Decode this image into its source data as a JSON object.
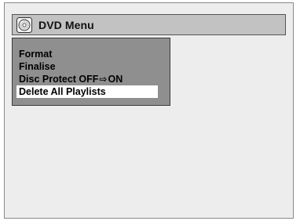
{
  "window": {
    "title": "DVD Menu",
    "icon": "disc-icon"
  },
  "menu": {
    "items": [
      {
        "label": "Format",
        "selected": false
      },
      {
        "label": "Finalise",
        "selected": false
      },
      {
        "label_before": "Disc Protect OFF",
        "arrow": "⇨",
        "label_after": "ON",
        "selected": false
      },
      {
        "label": "Delete All Playlists",
        "selected": true
      }
    ]
  },
  "colors": {
    "screen_background": "#ededed",
    "title_bar": "#c2c2c2",
    "menu_panel": "#8f8f8f",
    "selected_item": "#ffffff"
  }
}
